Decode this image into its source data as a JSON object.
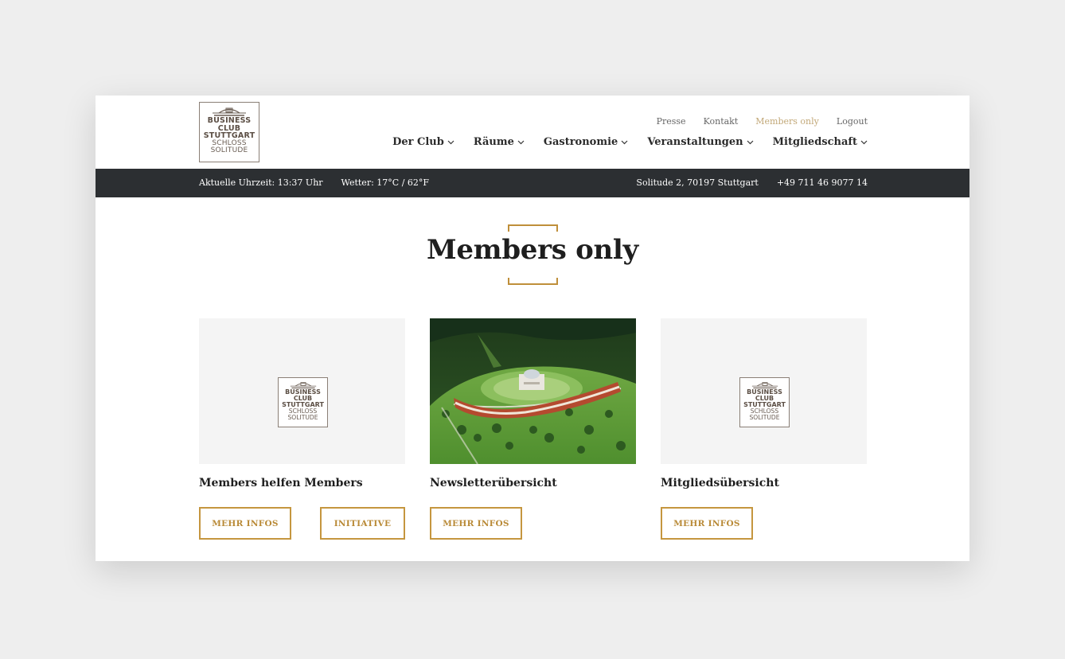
{
  "logo": {
    "line1": "BUSINESS",
    "line2": "CLUB",
    "line3": "STUTTGART",
    "line4": "SCHLOSS",
    "line5": "SOLITUDE"
  },
  "topnav": [
    {
      "label": "Presse",
      "active": false
    },
    {
      "label": "Kontakt",
      "active": false
    },
    {
      "label": "Members only",
      "active": true
    },
    {
      "label": "Logout",
      "active": false
    }
  ],
  "mainnav": [
    {
      "label": "Der Club"
    },
    {
      "label": "Räume"
    },
    {
      "label": "Gastronomie"
    },
    {
      "label": "Veranstaltungen"
    },
    {
      "label": "Mitgliedschaft"
    }
  ],
  "infobar": {
    "time": "Aktuelle Uhrzeit: 13:37 Uhr",
    "weather": "Wetter: 17°C / 62°F",
    "address": "Solitude 2, 70197 Stuttgart",
    "phone": "+49 711 46 9077 14"
  },
  "page": {
    "title": "Members only"
  },
  "cards": [
    {
      "title": "Members helfen Members",
      "image": "logo-placeholder",
      "buttons": [
        "MEHR INFOS",
        "INITIATIVE"
      ]
    },
    {
      "title": "Newsletterübersicht",
      "image": "aerial-photo-schloss-solitude",
      "buttons": [
        "MEHR INFOS"
      ]
    },
    {
      "title": "Mitgliedsübersicht",
      "image": "logo-placeholder",
      "buttons": [
        "MEHR INFOS"
      ]
    }
  ],
  "colors": {
    "accent": "#c5963f",
    "active_link": "#c2a878",
    "infobar_bg": "#2c2f32",
    "page_bg": "#eeeeee"
  }
}
